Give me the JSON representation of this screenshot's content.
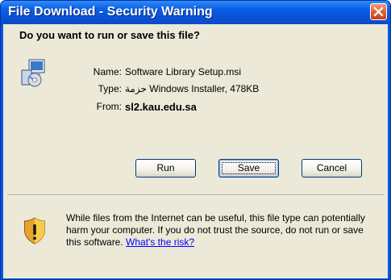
{
  "window": {
    "title": "File Download - Security Warning",
    "close_glyph": "close-icon"
  },
  "question": "Do you want to run or save this file?",
  "file_icon": "msi-installer-icon",
  "fields": {
    "name_label": "Name:",
    "name_value": "Software Library Setup.msi",
    "type_label": "Type:",
    "type_value": "حزمة Windows Installer, 478KB",
    "from_label": "From:",
    "from_value": "sl2.kau.edu.sa"
  },
  "buttons": {
    "run": "Run",
    "save": "Save",
    "cancel": "Cancel"
  },
  "warning": {
    "icon": "security-shield-icon",
    "text": "While files from the Internet can be useful, this file type can potentially harm your computer. If you do not trust the source, do not run or save this software.",
    "link": "What's the risk?"
  },
  "colors": {
    "titlebar": "#0a52d6",
    "dialog_bg": "#ece9d8",
    "close_button": "#e05b2d",
    "link": "#0000ff"
  }
}
